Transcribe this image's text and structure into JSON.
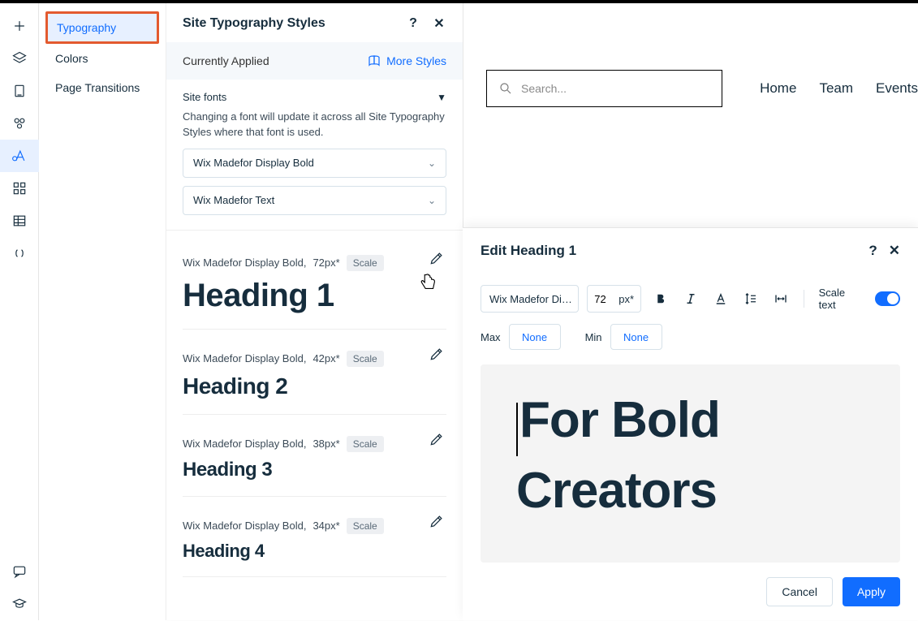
{
  "left_tools": [
    "add",
    "layers",
    "page",
    "components",
    "theme",
    "apps",
    "data",
    "cms"
  ],
  "design_menu": {
    "items": [
      "Typography",
      "Colors",
      "Page Transitions"
    ],
    "active_index": 0
  },
  "panel": {
    "title": "Site Typography Styles",
    "applied_label": "Currently Applied",
    "more_styles": "More Styles",
    "site_fonts_label": "Site fonts",
    "site_fonts_desc": "Changing a font will update it across all Site Typography Styles where that font is used.",
    "fonts": [
      "Wix Madefor Display Bold",
      "Wix Madefor Text"
    ],
    "styles": [
      {
        "font": "Wix Madefor Display Bold,",
        "size": "72px*",
        "badge": "Scale",
        "name": "Heading 1"
      },
      {
        "font": "Wix Madefor Display Bold,",
        "size": "42px*",
        "badge": "Scale",
        "name": "Heading 2"
      },
      {
        "font": "Wix Madefor Display Bold,",
        "size": "38px*",
        "badge": "Scale",
        "name": "Heading 3"
      },
      {
        "font": "Wix Madefor Display Bold,",
        "size": "34px*",
        "badge": "Scale",
        "name": "Heading 4"
      }
    ]
  },
  "site_preview": {
    "search_placeholder": "Search...",
    "nav": [
      "Home",
      "Team",
      "Events"
    ]
  },
  "edit": {
    "title": "Edit Heading 1",
    "font": "Wix Madefor Di…",
    "size_value": "72",
    "size_unit": "px*",
    "scale_text_label": "Scale text",
    "max_label": "Max",
    "min_label": "Min",
    "none_label": "None",
    "preview_text": "For Bold Creators",
    "cancel": "Cancel",
    "apply": "Apply"
  }
}
